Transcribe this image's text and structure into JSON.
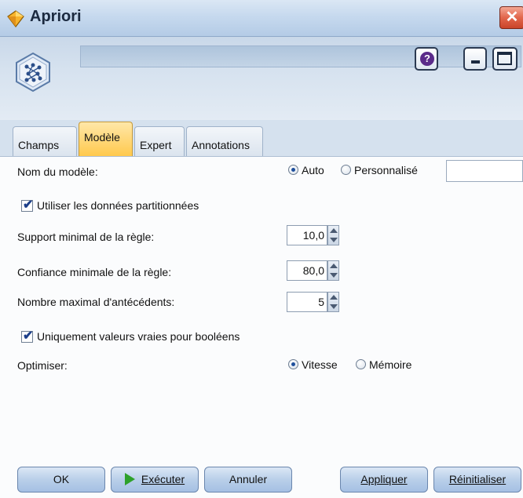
{
  "window": {
    "title": "Apriori",
    "close_glyph": "✕"
  },
  "header": {
    "help_glyph": "?"
  },
  "tabs": [
    {
      "label": "Champs"
    },
    {
      "label": "Modèle"
    },
    {
      "label": "Expert"
    },
    {
      "label": "Annotations"
    }
  ],
  "active_tab": "Modèle",
  "form": {
    "model_name": {
      "label": "Nom du modèle:",
      "options": [
        "Auto",
        "Personnalisé"
      ],
      "selected": "Auto",
      "custom_value": ""
    },
    "use_partitioned": {
      "label": "Utiliser les données partitionnées",
      "checked": true
    },
    "min_support": {
      "label": "Support minimal de la règle:",
      "value": "10,0"
    },
    "min_confidence": {
      "label": "Confiance minimale de la règle:",
      "value": "80,0"
    },
    "max_antecedents": {
      "label": "Nombre maximal d'antécédents:",
      "value": "5"
    },
    "true_values_only": {
      "label": "Uniquement valeurs vraies pour booléens",
      "checked": true
    },
    "optimize": {
      "label": "Optimiser:",
      "options": [
        "Vitesse",
        "Mémoire"
      ],
      "selected": "Vitesse"
    }
  },
  "footer": {
    "ok": "OK",
    "run": "Exécuter",
    "cancel": "Annuler",
    "apply": "Appliquer",
    "reset": "Réinitialiser"
  },
  "icons": {
    "title": "apriori-diamond-icon",
    "node": "apriori-node-icon",
    "run": "play-icon"
  },
  "colors": {
    "accent_tab": "#ffc94d",
    "run_icon": "#2ea12a",
    "title_gradient": "#c6d9ee"
  }
}
